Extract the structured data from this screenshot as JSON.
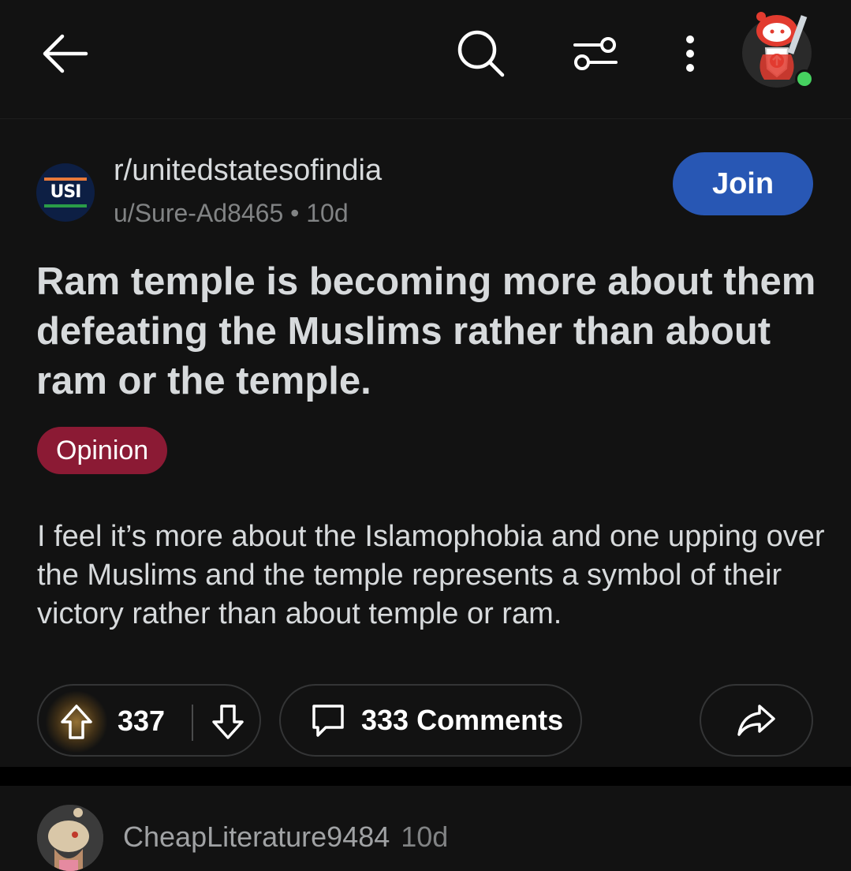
{
  "topbar": {
    "back_icon": "arrow-left-icon",
    "search_icon": "search-icon",
    "filter_icon": "sort-sliders-icon",
    "more_icon": "vertical-dots-icon",
    "avatar_icon": "snoo-avatar-icon",
    "online_status_color": "#46d160"
  },
  "post": {
    "subreddit": "r/unitedstatesofindia",
    "subreddit_logo_text": "USI",
    "author": "u/Sure-Ad8465",
    "separator": "•",
    "age": "10d",
    "join_label": "Join",
    "title": "Ram temple is becoming more about them defeating the Muslims rather than about ram or the temple.",
    "flair": "Opinion",
    "body": "I feel it’s more about the Islamophobia and one upping over the Muslims and the temple represents a symbol of their victory rather than about temple or ram.",
    "votes": "337",
    "comments_label": "333 Comments"
  },
  "comment": {
    "username": "CheapLiterature9484",
    "age": "10d"
  },
  "colors": {
    "background": "#121212",
    "join_button": "#2857b4",
    "flair": "#8b1a34",
    "text": "#d7dadc",
    "muted": "#818384"
  }
}
